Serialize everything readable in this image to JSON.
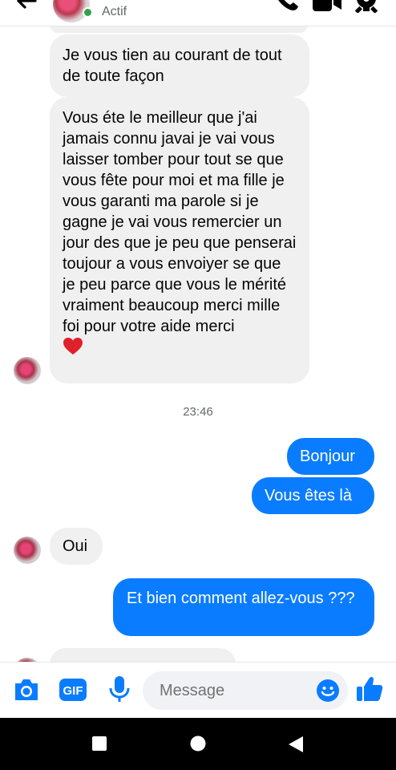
{
  "header": {
    "status": "Actif",
    "icons": [
      "back-arrow-icon",
      "phone-icon",
      "video-camera-icon",
      "settings-gear-icon"
    ]
  },
  "messages": [
    {
      "side": "in",
      "text": "Je vous tien au courant de tout de toute façon"
    },
    {
      "side": "in",
      "text": "Vous éte le meilleur que j'ai jamais connu javai je vai vous laisser tomber pour tout se que vous fête pour moi et ma fille je vous garanti ma parole si je gagne je vai vous remercier un jour des que je peu que penserai toujour a vous envoiyer se que je peu parce que vous le mérité vraiment beaucoup merci mille foi pour votre aide merci",
      "emoji": "heart-icon"
    },
    {
      "side": "time",
      "text": "23:46"
    },
    {
      "side": "out",
      "text": "Bonjour"
    },
    {
      "side": "out",
      "text": "Vous êtes là"
    },
    {
      "side": "in",
      "text": "Oui"
    },
    {
      "side": "out",
      "text": "Et bien comment allez-vous ???"
    }
  ],
  "composer": {
    "placeholder": "Message",
    "icons": [
      "camera-icon",
      "gif-icon",
      "microphone-icon",
      "emoji-icon",
      "thumbs-up-icon"
    ]
  },
  "colors": {
    "accent": "#0a7cff",
    "incoming_bubble": "#f0f0f0",
    "online": "#31a24c"
  }
}
